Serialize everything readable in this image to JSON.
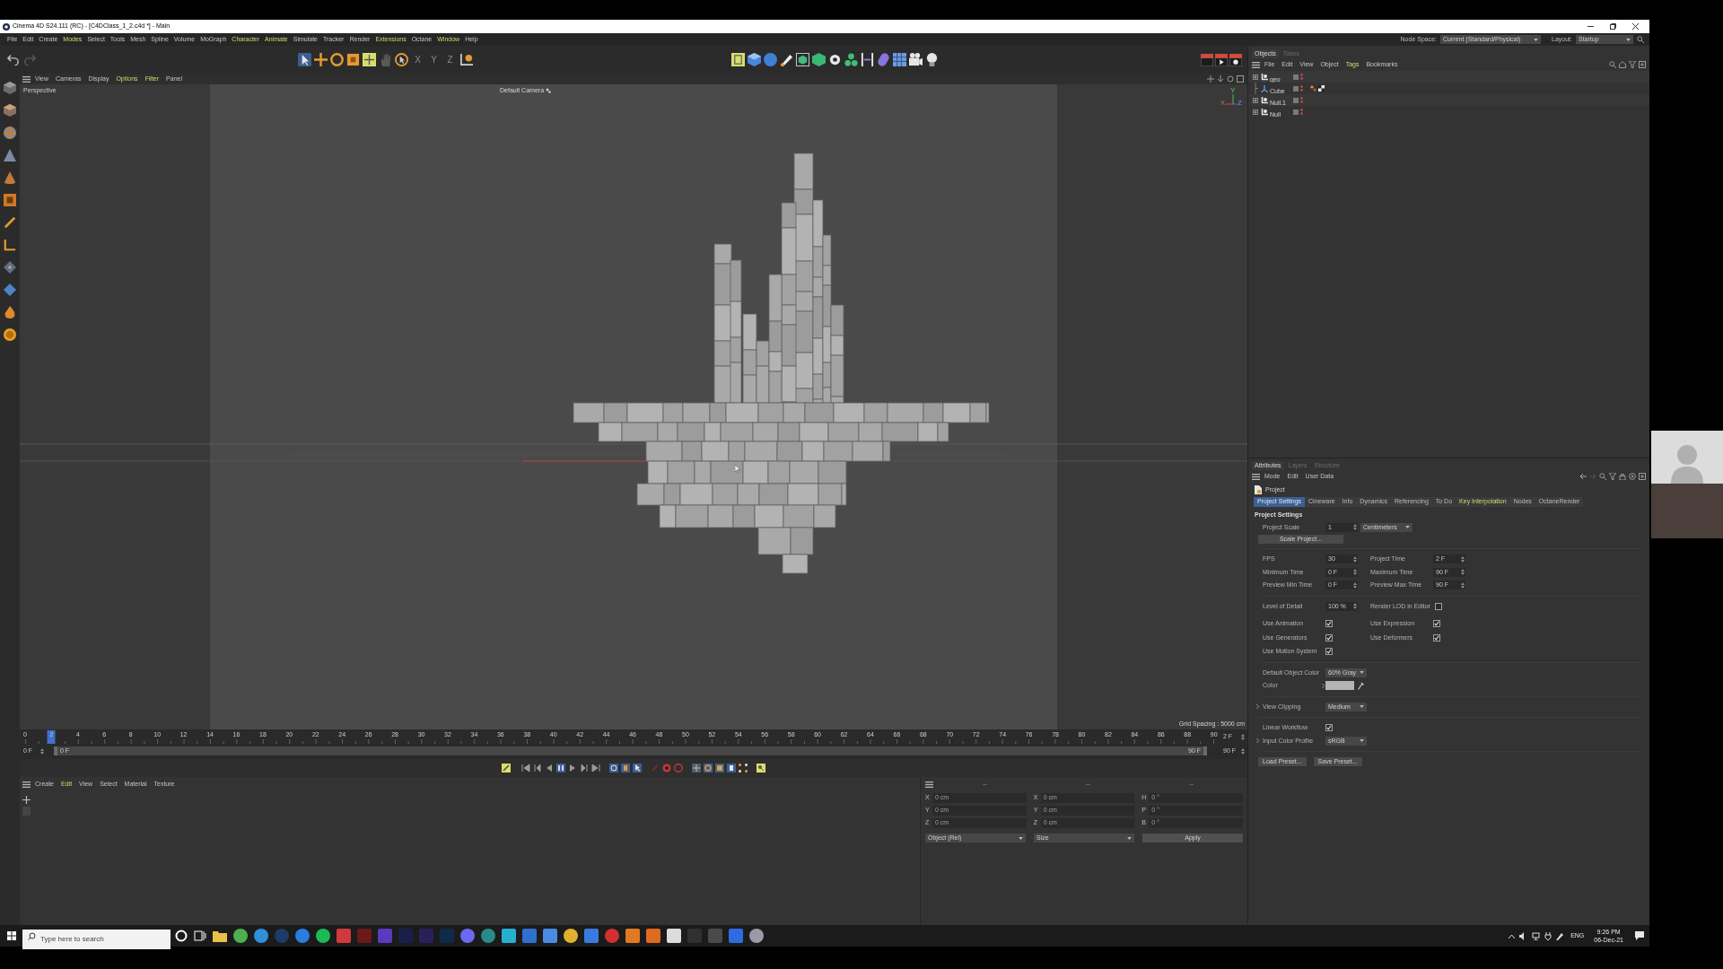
{
  "window": {
    "title": "Cinema 4D S24.111 (RC) - [C4DClass_1_2.c4d *] - Main"
  },
  "menu_bar": {
    "items": [
      {
        "label": "File",
        "highlighted": false
      },
      {
        "label": "Edit",
        "highlighted": false
      },
      {
        "label": "Create",
        "highlighted": false
      },
      {
        "label": "Modes",
        "highlighted": true
      },
      {
        "label": "Select",
        "highlighted": false
      },
      {
        "label": "Tools",
        "highlighted": false
      },
      {
        "label": "Mesh",
        "highlighted": false
      },
      {
        "label": "Spline",
        "highlighted": false
      },
      {
        "label": "Volume",
        "highlighted": false
      },
      {
        "label": "MoGraph",
        "highlighted": false
      },
      {
        "label": "Character",
        "highlighted": true
      },
      {
        "label": "Animate",
        "highlighted": true
      },
      {
        "label": "Simulate",
        "highlighted": false
      },
      {
        "label": "Tracker",
        "highlighted": false
      },
      {
        "label": "Render",
        "highlighted": false
      },
      {
        "label": "Extensions",
        "highlighted": true
      },
      {
        "label": "Octane",
        "highlighted": false
      },
      {
        "label": "Window",
        "highlighted": true
      },
      {
        "label": "Help",
        "highlighted": false
      }
    ],
    "node_space": {
      "label": "Node Space:",
      "value": "Current (Standard/Physical)"
    },
    "layout": {
      "label": "Layout:",
      "value": "Startup"
    }
  },
  "toolbar": {
    "axis_locks": [
      "X",
      "Y",
      "Z"
    ]
  },
  "viewport": {
    "menu": [
      {
        "label": "View",
        "highlighted": false
      },
      {
        "label": "Cameras",
        "highlighted": false
      },
      {
        "label": "Display",
        "highlighted": false
      },
      {
        "label": "Options",
        "highlighted": true
      },
      {
        "label": "Filter",
        "highlighted": true
      },
      {
        "label": "Panel",
        "highlighted": false
      }
    ],
    "view_name": "Perspective",
    "camera": "Default Camera",
    "axes": {
      "x": "X",
      "y": "Y",
      "z": "Z"
    },
    "grid_spacing": "Grid Spacing : 5000 cm"
  },
  "objects": {
    "tabs": [
      {
        "label": "Objects",
        "selected": true
      },
      {
        "label": "Takes",
        "selected": false
      }
    ],
    "menu": [
      {
        "label": "File",
        "highlighted": false
      },
      {
        "label": "Edit",
        "highlighted": false
      },
      {
        "label": "View",
        "highlighted": false
      },
      {
        "label": "Object",
        "highlighted": false
      },
      {
        "label": "Tags",
        "highlighted": true
      },
      {
        "label": "Bookmarks",
        "highlighted": false
      }
    ],
    "tree": [
      {
        "name": "geo",
        "kind": "null",
        "collapsed": true,
        "tagged": false
      },
      {
        "name": "Cube",
        "kind": "polygon",
        "collapsed": false,
        "tagged": true
      },
      {
        "name": "Null.1",
        "kind": "null",
        "collapsed": true,
        "tagged": false
      },
      {
        "name": "Null",
        "kind": "null",
        "collapsed": true,
        "tagged": false
      }
    ]
  },
  "attributes": {
    "tabs": [
      {
        "label": "Attributes",
        "selected": true
      },
      {
        "label": "Layers",
        "selected": false
      },
      {
        "label": "Structure",
        "selected": false
      }
    ],
    "menu": [
      "Mode",
      "Edit",
      "User Data"
    ],
    "object": "Project",
    "section_tabs": [
      {
        "label": "Project Settings",
        "selected": true,
        "highlighted": false
      },
      {
        "label": "Cineware",
        "selected": false,
        "highlighted": false
      },
      {
        "label": "Info",
        "selected": false,
        "highlighted": false
      },
      {
        "label": "Dynamics",
        "selected": false,
        "highlighted": false
      },
      {
        "label": "Referencing",
        "selected": false,
        "highlighted": false
      },
      {
        "label": "To Do",
        "selected": false,
        "highlighted": false
      },
      {
        "label": "Key Interpolation",
        "selected": false,
        "highlighted": true
      },
      {
        "label": "Nodes",
        "selected": false,
        "highlighted": false
      },
      {
        "label": "OctaneRender",
        "selected": false,
        "highlighted": false
      }
    ],
    "section_title": "Project Settings",
    "project_scale": {
      "label": "Project Scale",
      "value": "1",
      "unit": "Centimeters"
    },
    "scale_button": "Scale Project...",
    "time_rows": [
      [
        {
          "label": "FPS",
          "value": "30"
        },
        {
          "label": "Project Time",
          "value": "2 F"
        }
      ],
      [
        {
          "label": "Minimum Time",
          "value": "0 F"
        },
        {
          "label": "Maximum Time",
          "value": "90 F"
        }
      ],
      [
        {
          "label": "Preview Min Time",
          "value": "0 F"
        },
        {
          "label": "Preview Max Time",
          "value": "90 F"
        }
      ]
    ],
    "level_of_detail": {
      "label": "Level of Detail",
      "value": "100 %"
    },
    "render_lod": {
      "label": "Render LOD in Editor",
      "checked": false
    },
    "usage_rows": [
      [
        {
          "label": "Use Animation",
          "checked": true
        },
        {
          "label": "Use Expression",
          "checked": true
        }
      ],
      [
        {
          "label": "Use Generators",
          "checked": true
        },
        {
          "label": "Use Deformers",
          "checked": true
        }
      ],
      [
        {
          "label": "Use Motion System",
          "checked": true
        }
      ]
    ],
    "default_object_color": {
      "label": "Default Object Color",
      "value": "60% Gray"
    },
    "color": {
      "label": "Color",
      "color": "#b4b4b4"
    },
    "view_clipping": {
      "label": "View Clipping",
      "value": "Medium"
    },
    "linear_workflow": {
      "label": "Linear Workflow",
      "checked": true
    },
    "input_color_profile": {
      "label": "Input Color Profile",
      "value": "sRGB"
    },
    "preset_buttons": [
      "Load Preset...",
      "Save Preset..."
    ]
  },
  "timeline": {
    "ruler": [
      "0",
      "2",
      "4",
      "6",
      "8",
      "10",
      "12",
      "14",
      "16",
      "18",
      "20",
      "22",
      "24",
      "26",
      "28",
      "30",
      "32",
      "34",
      "36",
      "38",
      "40",
      "42",
      "44",
      "46",
      "48",
      "50",
      "52",
      "54",
      "56",
      "58",
      "60",
      "62",
      "64",
      "66",
      "68",
      "70",
      "72",
      "74",
      "76",
      "78",
      "80",
      "82",
      "84",
      "86",
      "88",
      "90"
    ],
    "playhead": {
      "level": 0.022
    },
    "current_frame": "2 F",
    "start_field": "0 F",
    "range": {
      "start": "0 F",
      "end": "90 F",
      "start_handle": {
        "level": 0
      },
      "end_handle": {
        "level": 1
      }
    },
    "end_field": "90 F"
  },
  "material_manager": {
    "menu": [
      {
        "label": "Create",
        "highlighted": false
      },
      {
        "label": "Edit",
        "highlighted": true
      },
      {
        "label": "View",
        "highlighted": false
      },
      {
        "label": "Select",
        "highlighted": false
      },
      {
        "label": "Material",
        "highlighted": false
      },
      {
        "label": "Texture",
        "highlighted": false
      }
    ]
  },
  "coordinates": {
    "headers": [
      "--",
      "--",
      "--"
    ],
    "rows": [
      [
        {
          "axis": "X",
          "value": "0 cm"
        },
        {
          "axis": "X",
          "value": "0 cm"
        },
        {
          "axis": "H",
          "value": "0 °"
        }
      ],
      [
        {
          "axis": "Y",
          "value": "0 cm"
        },
        {
          "axis": "Y",
          "value": "0 cm"
        },
        {
          "axis": "P",
          "value": "0 °"
        }
      ],
      [
        {
          "axis": "Z",
          "value": "0 cm"
        },
        {
          "axis": "Z",
          "value": "0 cm"
        },
        {
          "axis": "B",
          "value": "0 °"
        }
      ]
    ],
    "mode": "Object (Rel)",
    "size_mode": "Size",
    "apply": "Apply"
  },
  "taskbar": {
    "search": {
      "placeholder": "Type here to search"
    },
    "language": "ENG",
    "time": "9:26 PM",
    "date": "06-Dec-21"
  }
}
